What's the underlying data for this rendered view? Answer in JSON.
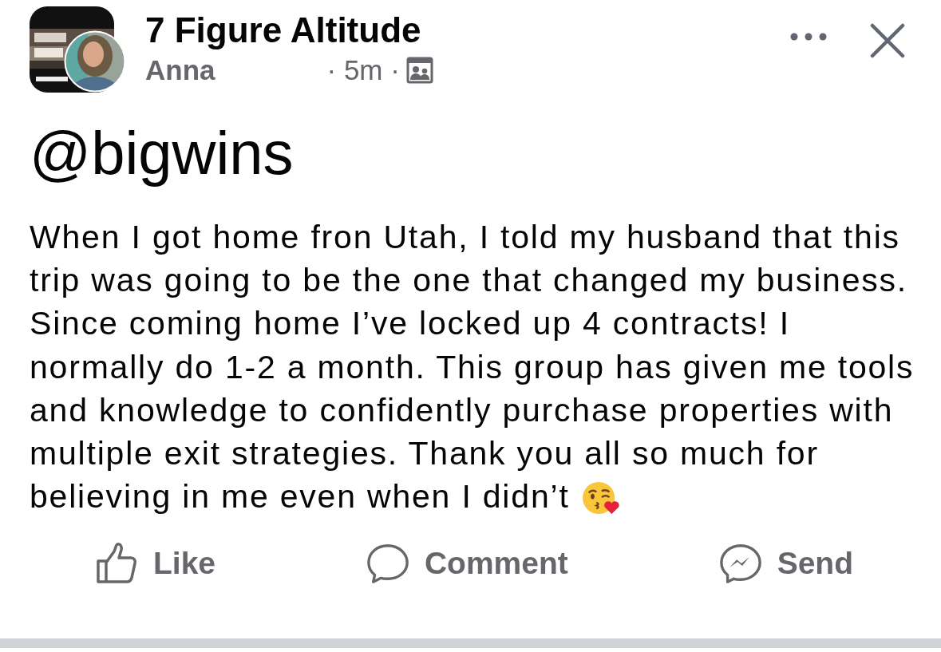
{
  "post": {
    "group_name": "7 Figure Altitude",
    "author": "Anna",
    "time": "· 5m ·",
    "heading": "@bigwins",
    "body": "When I got home fron Utah, I told my husband that this trip was going to be the one that changed my business. Since coming home I’ve locked up 4 contracts! I normally do 1-2 a month. This group has given me tools and knowledge to confidently purchase properties with multiple exit strategies. Thank you all so much for believing in me even when I didn’t"
  },
  "actions": [
    {
      "kind": "like",
      "label": "Like"
    },
    {
      "kind": "comment",
      "label": "Comment"
    },
    {
      "kind": "send",
      "label": "Send"
    }
  ]
}
